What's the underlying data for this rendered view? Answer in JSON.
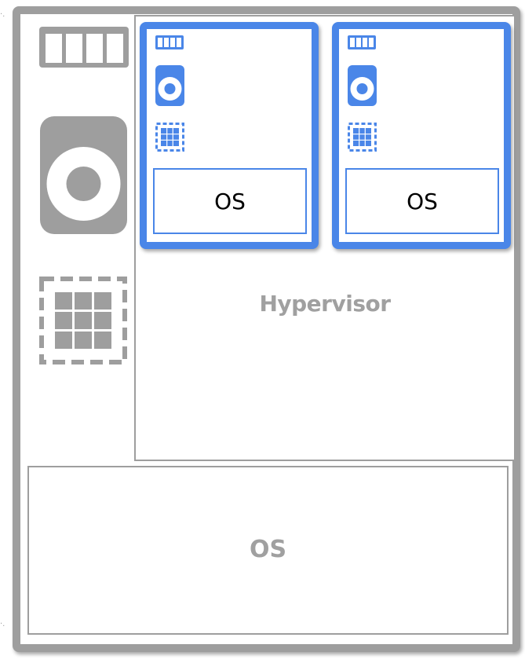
{
  "diagram": {
    "hypervisor_label": "Hypervisor",
    "host_os_label": "OS",
    "vms": [
      {
        "os_label": "OS"
      },
      {
        "os_label": "OS"
      }
    ],
    "colors": {
      "host_gray": "#9e9e9e",
      "label_gray": "#a0a0a0",
      "vm_blue": "#4a86e8"
    },
    "icons": {
      "host": [
        "memory-icon",
        "disk-icon",
        "cpu-icon"
      ],
      "vm": [
        "memory-icon",
        "disk-icon",
        "cpu-icon"
      ]
    }
  }
}
